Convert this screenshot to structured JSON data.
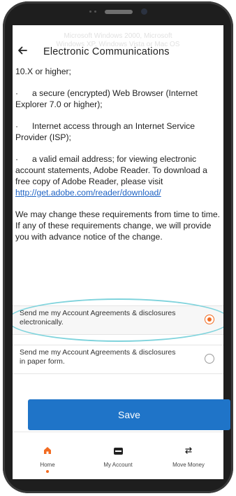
{
  "header": {
    "ghost_text": "Microsoft Windows 2000, Microsoft\nWindows XP, Windows Vista or Mac OS",
    "title": "Electronic Communications",
    "back_icon": "arrow-left-icon"
  },
  "content": {
    "line1": "10.X or higher;",
    "bullet": "·",
    "item_browser": "a secure (encrypted) Web Browser (Internet Explorer 7.0 or higher);",
    "item_internet": "Internet access through an Internet Service Provider (ISP);",
    "item_email_prefix": "a valid email address; for viewing electronic account statements, Adobe Reader. To download a free copy of Adobe Reader, please visit ",
    "item_email_link": "http://get.adobe.com/reader/download/",
    "notice": "We may change these requirements from time to time. If any of these requirements change, we will provide you with advance notice of the change."
  },
  "options": [
    {
      "label": "Send me my Account Agreements & disclosures electronically.",
      "selected": true
    },
    {
      "label": "Send me my Account Agreements & disclosures in paper form.",
      "selected": false
    }
  ],
  "save_label": "Save",
  "tabs": [
    {
      "label": "Home",
      "icon": "home-icon",
      "active": true
    },
    {
      "label": "My Account",
      "icon": "card-icon",
      "active": false
    },
    {
      "label": "Move Money",
      "icon": "transfer-icon",
      "active": false
    }
  ],
  "colors": {
    "accent": "#f26b21",
    "primary": "#1f74c8",
    "highlight": "#7fd3dc"
  }
}
